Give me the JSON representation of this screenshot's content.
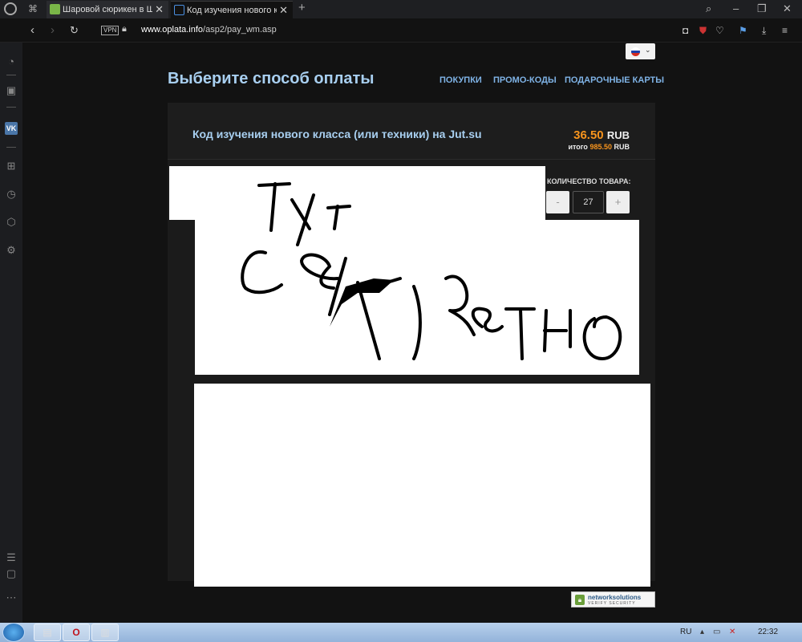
{
  "browser": {
    "tabs": [
      {
        "title": "Шаровой сюрикен в Шко"
      },
      {
        "title": "Код изучения нового клас"
      }
    ],
    "url_domain": "www.oplata.info",
    "url_path": "/asp2/pay_wm.asp",
    "vpn_label": "VPN",
    "icons": {
      "back": "chevron-left-icon",
      "forward": "chevron-right-icon",
      "reload": "reload-icon",
      "camera": "camera-icon",
      "shield": "shield-icon",
      "heart": "heart-icon",
      "flow": "flow-icon",
      "download": "download-icon",
      "menu": "menu-icon"
    }
  },
  "sidebar": {
    "items": [
      "speed-dial-icon",
      "twitch-icon",
      "vk-icon",
      "workspaces-icon",
      "history-icon",
      "extensions-icon",
      "settings-icon"
    ],
    "vk_label": "VK"
  },
  "page": {
    "title": "Выберите способ оплаты",
    "nav": [
      "ПОКУПКИ",
      "ПРОМО-КОДЫ",
      "ПОДАРОЧНЫЕ КАРТЫ"
    ],
    "product": "Код изучения нового класса (или техники) на Jut.su",
    "price_value": "36.50",
    "price_currency": "RUB",
    "total_label": "итого",
    "total_value": "985.50",
    "total_currency": "RUB",
    "qty_label": "КОЛИЧЕСТВО ТОВАРА:",
    "qty_minus": "-",
    "qty_value": "27",
    "qty_plus": "+"
  },
  "badge": {
    "name": "networksolutions",
    "sub": "VERIFY SECURITY"
  },
  "taskbar": {
    "lang": "RU",
    "time": "22:32"
  },
  "colors": {
    "accent_blue": "#a8cff0",
    "price_orange": "#f7941d"
  }
}
